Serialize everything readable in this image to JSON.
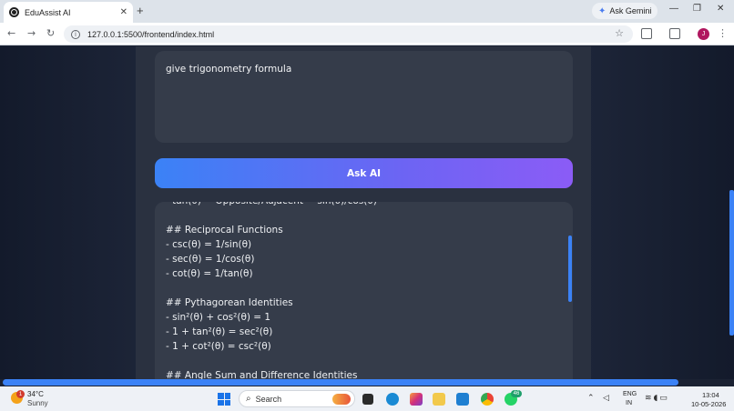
{
  "browser": {
    "tab_title": "EduAssist AI",
    "tab_close": "✕",
    "new_tab": "+",
    "gemini_label": "Ask Gemini",
    "url": "127.0.0.1:5500/frontend/index.html",
    "avatar_initial": "J",
    "window_minimize": "—",
    "window_restore": "❐",
    "window_close": "✕"
  },
  "app": {
    "prompt_text": "give trigonometry formula",
    "ask_button_label": "Ask AI",
    "answer_lines": [
      "- tan(θ) = Opposite/Adjacent = sin(θ)/cos(θ)",
      "",
      "## Reciprocal Functions",
      "- csc(θ) = 1/sin(θ)",
      "- sec(θ) = 1/cos(θ)",
      "- cot(θ) = 1/tan(θ)",
      "",
      "## Pythagorean Identities",
      "- sin²(θ) + cos²(θ) = 1",
      "- 1 + tan²(θ) = sec²(θ)",
      "- 1 + cot²(θ) = csc²(θ)",
      "",
      "## Angle Sum and Difference Identities"
    ]
  },
  "taskbar": {
    "weather_badge": "1",
    "temperature": "34°C",
    "condition": "Sunny",
    "search_label": "Search",
    "whatsapp_badge": "46",
    "lang_line1": "ENG",
    "lang_line2": "IN",
    "time": "13:04",
    "date": "10-05-2026"
  },
  "colors": {
    "accent_blue": "#3b82f6",
    "accent_purple": "#8b5cf6",
    "panel": "#353c4a",
    "container": "#2a3140"
  }
}
